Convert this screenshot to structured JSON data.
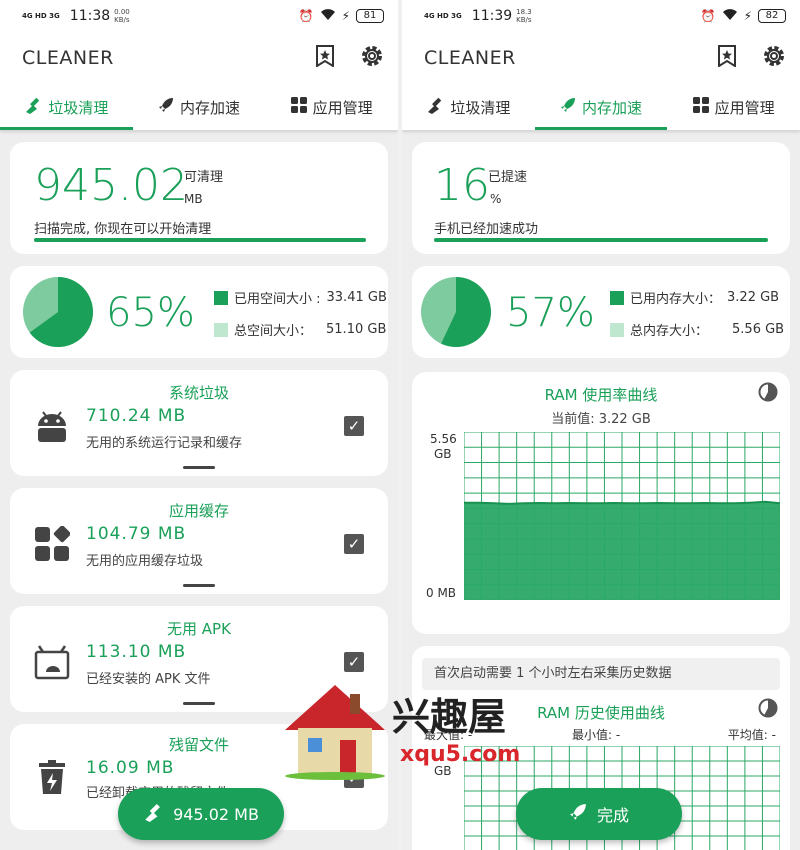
{
  "left": {
    "status": {
      "net": "4G HD 3G",
      "speed": "0.00\nKB/s",
      "time": "11:38",
      "battery": "81"
    },
    "app_title": "CLEANER",
    "tabs": [
      "垃圾清理",
      "内存加速",
      "应用管理"
    ],
    "summary": {
      "value": "945.02",
      "unit": "MB",
      "label": "可清理",
      "message": "扫描完成, 你现在可以开始清理"
    },
    "usage": {
      "percent": "65%",
      "fraction": 0.65,
      "used_label": "已用空间大小 :",
      "used_value": "33.41 GB",
      "total_label": "总空间大小：",
      "total_value": "51.10 GB"
    },
    "categories": [
      {
        "title": "系统垃圾",
        "size": "710.24 MB",
        "desc": "无用的系统运行记录和缓存",
        "icon": "android-icon"
      },
      {
        "title": "应用缓存",
        "size": "104.79 MB",
        "desc": "无用的应用缓存垃圾",
        "icon": "apps-icon"
      },
      {
        "title": "无用 APK",
        "size": "113.10 MB",
        "desc": "已经安装的 APK 文件",
        "icon": "apk-icon"
      },
      {
        "title": "残留文件",
        "size": "16.09 MB",
        "desc": "已经卸载应用的残留文件",
        "icon": "trash-icon"
      }
    ],
    "fab_label": "945.02 MB"
  },
  "right": {
    "status": {
      "net": "4G HD 3G",
      "speed": "18.3\nKB/s",
      "time": "11:39",
      "battery": "82"
    },
    "app_title": "CLEANER",
    "tabs": [
      "垃圾清理",
      "内存加速",
      "应用管理"
    ],
    "summary": {
      "value": "16",
      "unit": "%",
      "label": "已提速",
      "message": "手机已经加速成功"
    },
    "usage": {
      "percent": "57%",
      "fraction": 0.57,
      "used_label": "已用内存大小：",
      "used_value": "3.22 GB",
      "total_label": "总内存大小：",
      "total_value": "5.56 GB"
    },
    "ram_chart": {
      "title": "RAM 使用率曲线",
      "current": "当前值: 3.22 GB",
      "y_top": "5.56",
      "y_top_unit": "GB",
      "y_bottom": "0 MB"
    },
    "history_notice": "首次启动需要 1 个小时左右采集历史数据",
    "history_chart": {
      "title": "RAM 历史使用曲线",
      "max": "最大值: -",
      "min": "最小值: -",
      "avg": "平均值: -",
      "y_unit": "GB"
    },
    "fab_label": "完成"
  },
  "watermark": {
    "text": "兴趣屋",
    "url": "xqu5.com"
  },
  "chart_data": {
    "type": "area",
    "title": "RAM 使用率曲线",
    "ylabel": "",
    "ylim": [
      0,
      5.56
    ],
    "y_units": "GB",
    "values": [
      3.22,
      3.22,
      3.2,
      3.18,
      3.2,
      3.21,
      3.2,
      3.21,
      3.2,
      3.2,
      3.21,
      3.2,
      3.2,
      3.21,
      3.2,
      3.2,
      3.21,
      3.2,
      3.2,
      3.22,
      3.25,
      3.2
    ]
  },
  "colors": {
    "accent": "#1aa058",
    "accent_light": "#7fcba0",
    "card": "#ffffff",
    "background": "#eeeeee"
  }
}
